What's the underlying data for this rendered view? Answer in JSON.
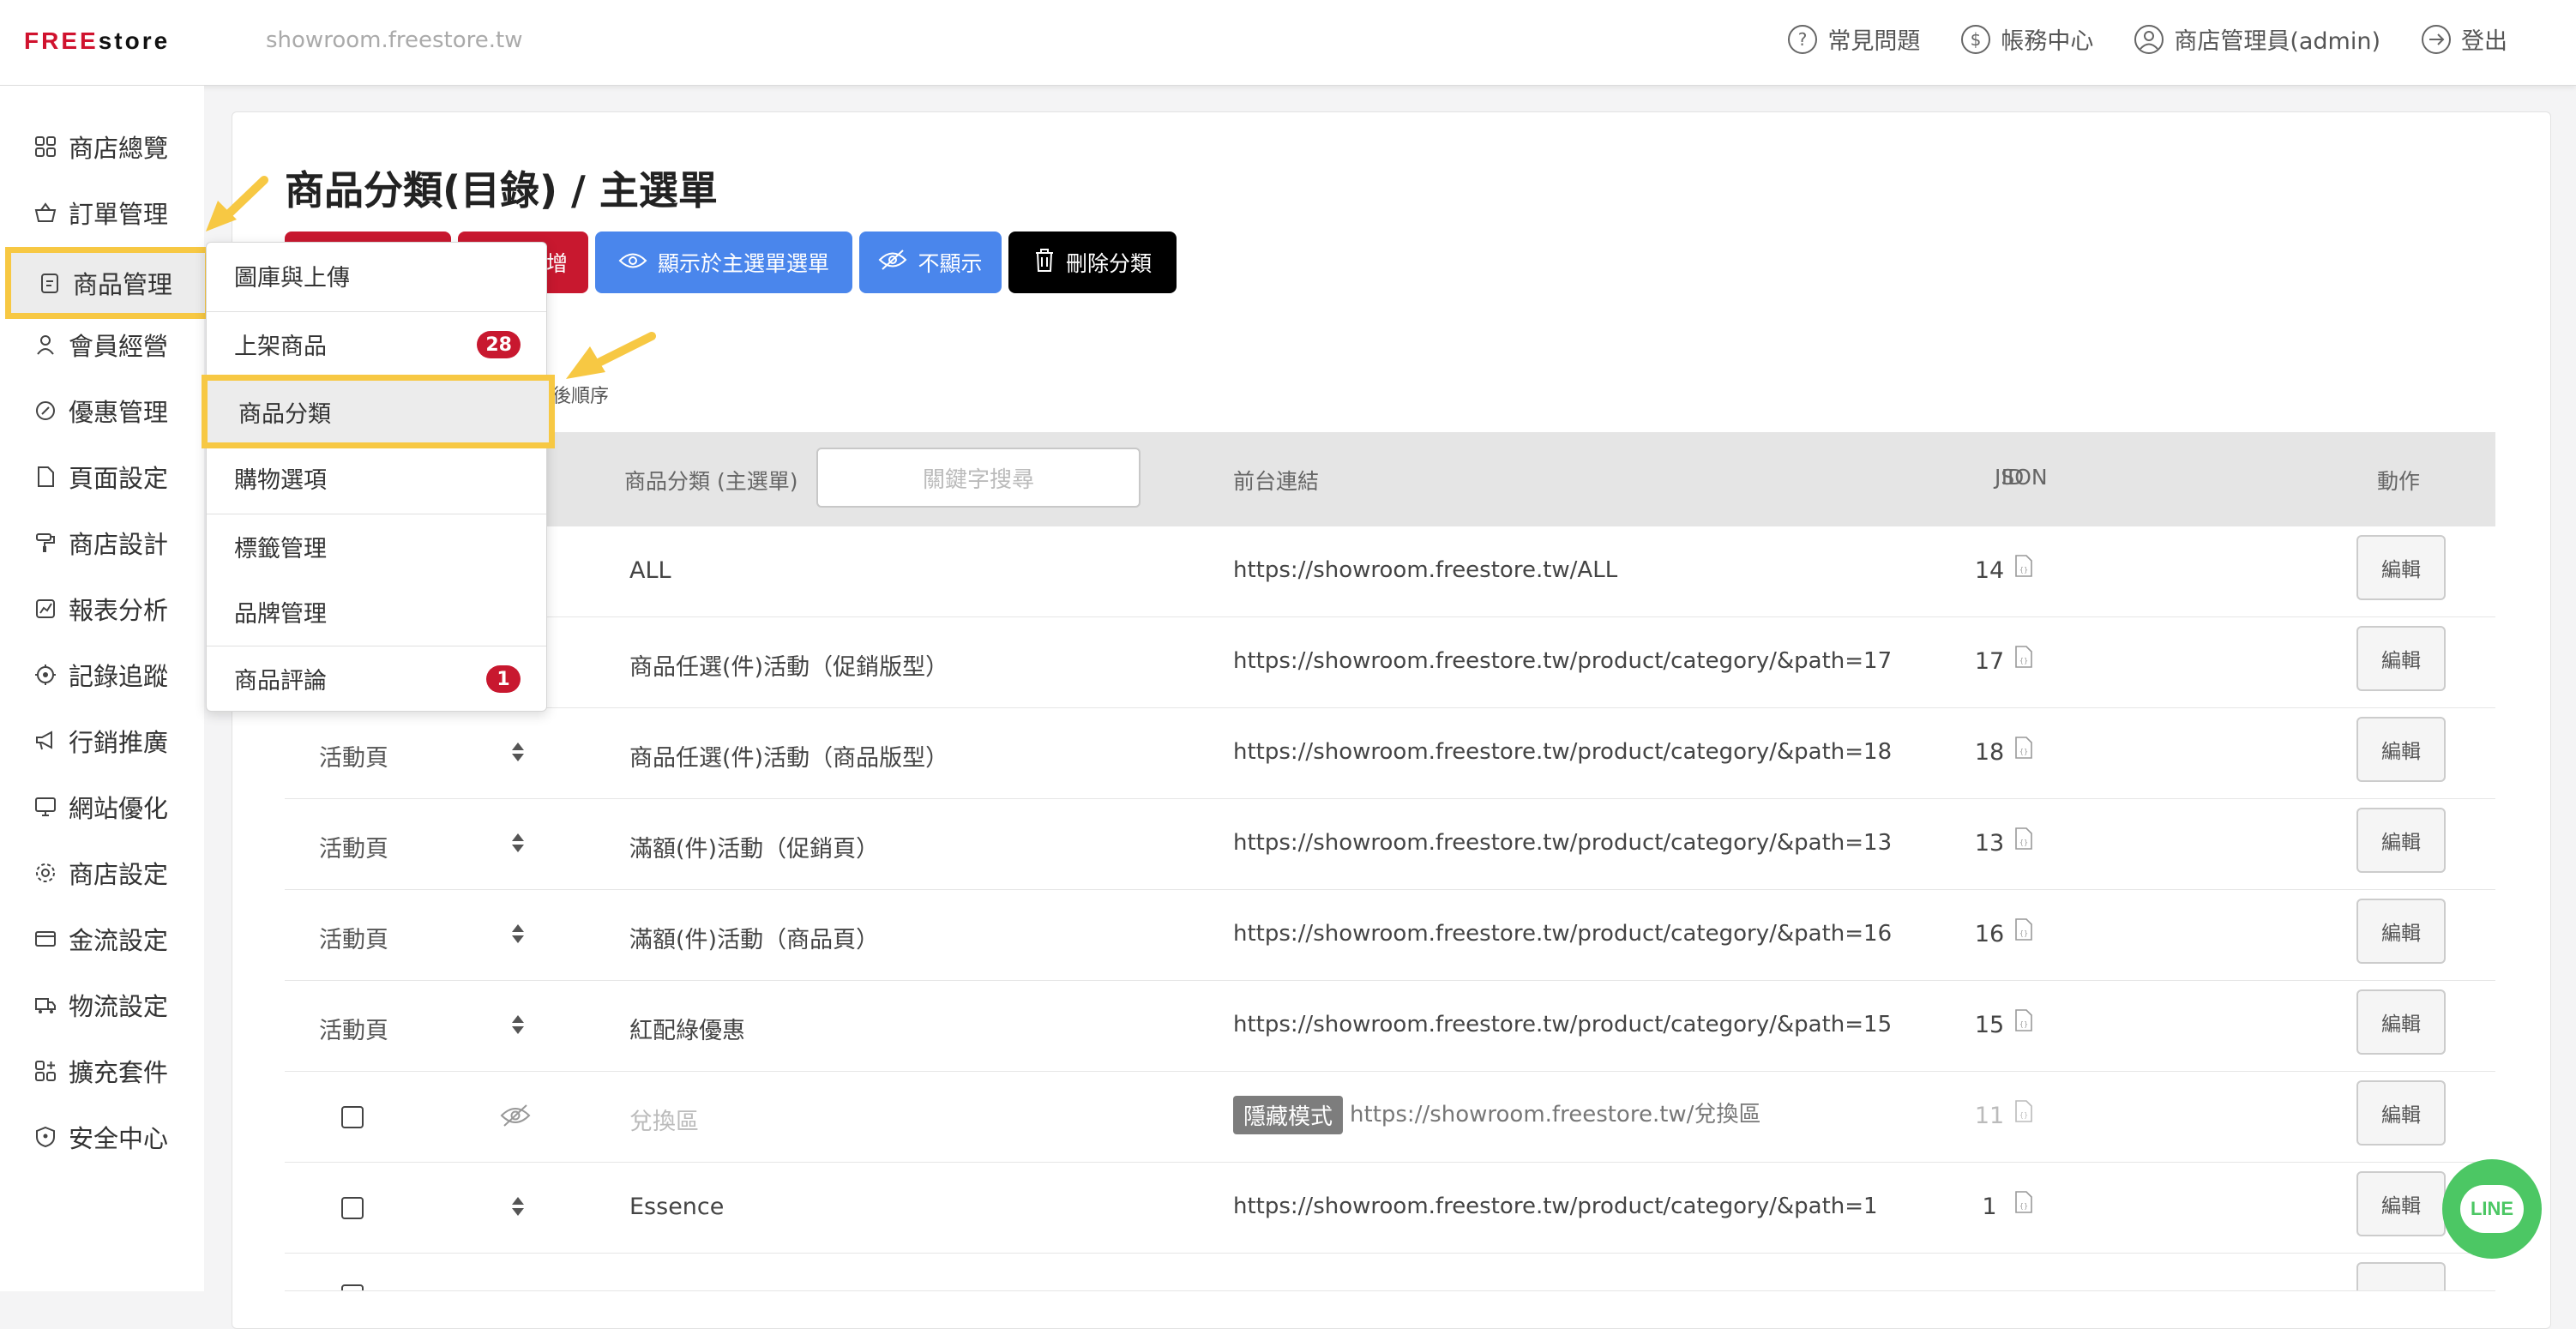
{
  "header": {
    "logo_prefix": "FREE",
    "logo_suffix": "store",
    "site_url": "showroom.freestore.tw",
    "menu": [
      {
        "label": "常見問題",
        "icon": "question-circle-icon"
      },
      {
        "label": "帳務中心",
        "icon": "dollar-circle-icon"
      },
      {
        "label": "商店管理員(admin)",
        "icon": "user-circle-icon"
      },
      {
        "label": "登出",
        "icon": "logout-icon"
      }
    ]
  },
  "sidebar": {
    "items": [
      {
        "label": "商店總覽",
        "icon": "grid-icon"
      },
      {
        "label": "訂單管理",
        "icon": "basket-icon"
      },
      {
        "label": "商品管理",
        "icon": "clipboard-icon"
      },
      {
        "label": "會員經營",
        "icon": "person-icon"
      },
      {
        "label": "優惠管理",
        "icon": "badge-percent-icon"
      },
      {
        "label": "頁面設定",
        "icon": "page-icon"
      },
      {
        "label": "商店設計",
        "icon": "paint-roller-icon"
      },
      {
        "label": "報表分析",
        "icon": "chart-icon"
      },
      {
        "label": "記錄追蹤",
        "icon": "target-icon"
      },
      {
        "label": "行銷推廣",
        "icon": "megaphone-icon"
      },
      {
        "label": "網站優化",
        "icon": "monitor-icon"
      },
      {
        "label": "商店設定",
        "icon": "gear-icon"
      },
      {
        "label": "金流設定",
        "icon": "card-icon"
      },
      {
        "label": "物流設定",
        "icon": "truck-icon"
      },
      {
        "label": "擴充套件",
        "icon": "plugin-icon"
      },
      {
        "label": "安全中心",
        "icon": "shield-icon"
      }
    ]
  },
  "dropdown": {
    "items": [
      {
        "label": "圖庫與上傳",
        "badge": ""
      },
      {
        "label": "上架商品",
        "badge": "28"
      },
      {
        "label": "商品分類",
        "badge": ""
      },
      {
        "label": "購物選項",
        "badge": ""
      },
      {
        "label": "標籤管理",
        "badge": ""
      },
      {
        "label": "品牌管理",
        "badge": ""
      },
      {
        "label": "商品評論",
        "badge": "1"
      }
    ]
  },
  "page": {
    "title": "商品分類(目錄) / 主選單",
    "buttons": {
      "add_partial": "增",
      "show_in_menu": "顯示於主選單選單",
      "hide": "不顯示",
      "delete": "刪除分類"
    },
    "sort_hint": "先後順序"
  },
  "table": {
    "headers": {
      "name": "商品分類 (主選單)",
      "link": "前台連結",
      "json": "JSON",
      "id": "ID",
      "action": "動作"
    },
    "search_placeholder": "關鍵字搜尋",
    "hidden_label": "隱藏模式",
    "edit_label": "編輯",
    "rows": [
      {
        "type": "",
        "name": "ALL",
        "link": "https://showroom.freestore.tw/ALL",
        "id": "14"
      },
      {
        "type": "",
        "name": "商品任選(件)活動（促銷版型）",
        "link": "https://showroom.freestore.tw/product/category/&path=17",
        "id": "17"
      },
      {
        "type": "活動頁",
        "name": "商品任選(件)活動（商品版型）",
        "link": "https://showroom.freestore.tw/product/category/&path=18",
        "id": "18"
      },
      {
        "type": "活動頁",
        "name": "滿額(件)活動（促銷頁）",
        "link": "https://showroom.freestore.tw/product/category/&path=13",
        "id": "13"
      },
      {
        "type": "活動頁",
        "name": "滿額(件)活動（商品頁）",
        "link": "https://showroom.freestore.tw/product/category/&path=16",
        "id": "16"
      },
      {
        "type": "活動頁",
        "name": "紅配綠優惠",
        "link": "https://showroom.freestore.tw/product/category/&path=15",
        "id": "15"
      },
      {
        "type": "",
        "name": "兌換區",
        "link": "https://showroom.freestore.tw/兌換區",
        "id": "11"
      },
      {
        "type": "",
        "name": "Essence",
        "link": "https://showroom.freestore.tw/product/category/&path=1",
        "id": "1"
      }
    ]
  },
  "line_button": {
    "label": "LINE"
  },
  "colors": {
    "accent_red": "#c8182f",
    "accent_blue": "#4a86ec",
    "highlight_yellow": "#f7c843",
    "line_green": "#4cc764"
  }
}
